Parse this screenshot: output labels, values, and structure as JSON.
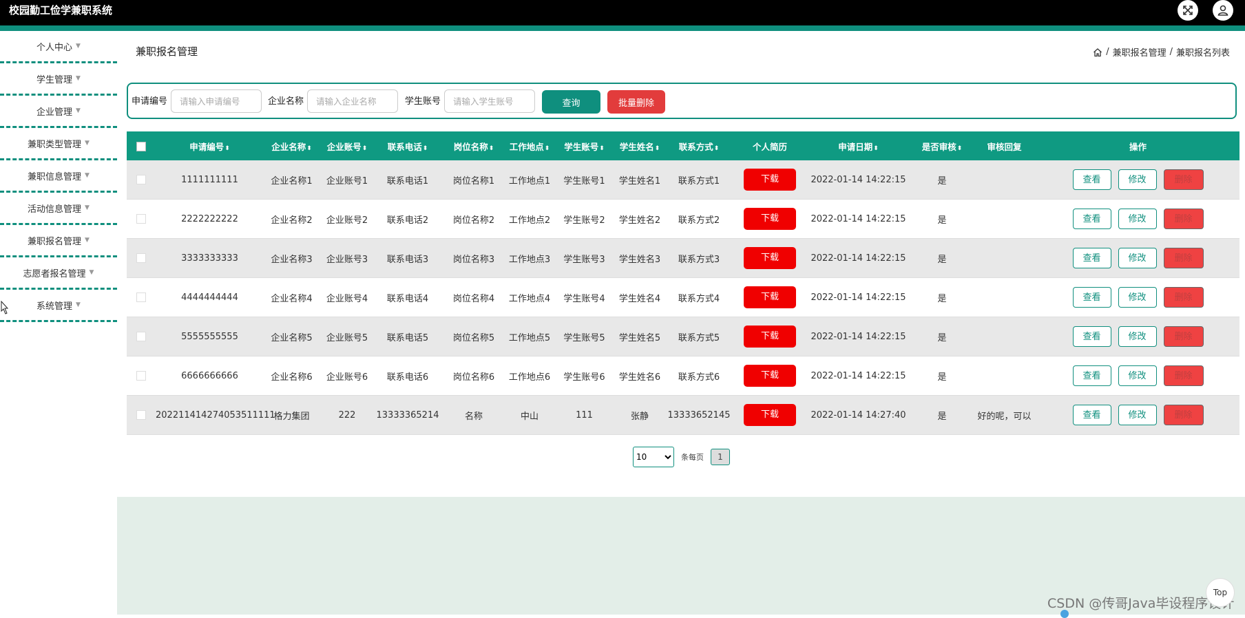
{
  "header": {
    "app_title": "校园勤工俭学兼职系统",
    "fullscreen_icon": "fullscreen-icon",
    "user_icon": "user-icon",
    "accent_color": "#0f8f7e"
  },
  "sidebar": {
    "items": [
      {
        "label": "个人中心"
      },
      {
        "label": "学生管理"
      },
      {
        "label": "企业管理"
      },
      {
        "label": "兼职类型管理"
      },
      {
        "label": "兼职信息管理"
      },
      {
        "label": "活动信息管理"
      },
      {
        "label": "兼职报名管理"
      },
      {
        "label": "志愿者报名管理"
      },
      {
        "label": "系统管理"
      }
    ]
  },
  "page": {
    "title": "兼职报名管理",
    "breadcrumb": [
      "兼职报名管理",
      "兼职报名列表"
    ],
    "breadcrumb_sep": "/"
  },
  "search": {
    "fields": [
      {
        "label": "申请编号",
        "placeholder": "请输入申请编号"
      },
      {
        "label": "企业名称",
        "placeholder": "请输入企业名称"
      },
      {
        "label": "学生账号",
        "placeholder": "请输入学生账号"
      }
    ],
    "query_label": "查询",
    "batch_delete_label": "批量删除"
  },
  "table": {
    "columns": [
      {
        "label": "申请编号",
        "sortable": true
      },
      {
        "label": "企业名称",
        "sortable": true
      },
      {
        "label": "企业账号",
        "sortable": true
      },
      {
        "label": "联系电话",
        "sortable": true
      },
      {
        "label": "岗位名称",
        "sortable": true
      },
      {
        "label": "工作地点",
        "sortable": true
      },
      {
        "label": "学生账号",
        "sortable": true
      },
      {
        "label": "学生姓名",
        "sortable": true
      },
      {
        "label": "联系方式",
        "sortable": true
      },
      {
        "label": "个人简历",
        "sortable": false
      },
      {
        "label": "申请日期",
        "sortable": true
      },
      {
        "label": "是否审核",
        "sortable": true
      },
      {
        "label": "审核回复",
        "sortable": false
      },
      {
        "label": "操作",
        "sortable": false
      }
    ],
    "download_label": "下载",
    "view_label": "查看",
    "edit_label": "修改",
    "delete_label": "删除",
    "rows": [
      [
        "1111111111",
        "企业名称1",
        "企业账号1",
        "联系电话1",
        "岗位名称1",
        "工作地点1",
        "学生账号1",
        "学生姓名1",
        "联系方式1",
        "2022-01-14 14:22:15",
        "是",
        ""
      ],
      [
        "2222222222",
        "企业名称2",
        "企业账号2",
        "联系电话2",
        "岗位名称2",
        "工作地点2",
        "学生账号2",
        "学生姓名2",
        "联系方式2",
        "2022-01-14 14:22:15",
        "是",
        ""
      ],
      [
        "3333333333",
        "企业名称3",
        "企业账号3",
        "联系电话3",
        "岗位名称3",
        "工作地点3",
        "学生账号3",
        "学生姓名3",
        "联系方式3",
        "2022-01-14 14:22:15",
        "是",
        ""
      ],
      [
        "4444444444",
        "企业名称4",
        "企业账号4",
        "联系电话4",
        "岗位名称4",
        "工作地点4",
        "学生账号4",
        "学生姓名4",
        "联系方式4",
        "2022-01-14 14:22:15",
        "是",
        ""
      ],
      [
        "5555555555",
        "企业名称5",
        "企业账号5",
        "联系电话5",
        "岗位名称5",
        "工作地点5",
        "学生账号5",
        "学生姓名5",
        "联系方式5",
        "2022-01-14 14:22:15",
        "是",
        ""
      ],
      [
        "6666666666",
        "企业名称6",
        "企业账号6",
        "联系电话6",
        "岗位名称6",
        "工作地点6",
        "学生账号6",
        "学生姓名6",
        "联系方式6",
        "2022-01-14 14:22:15",
        "是",
        ""
      ],
      [
        "202211414274053511111",
        "格力集团",
        "222",
        "13333365214",
        "名称",
        "中山",
        "111",
        "张静",
        "13333652145",
        "2022-01-14 14:27:40",
        "是",
        "好的呢，可以"
      ]
    ]
  },
  "pagination": {
    "page_size": "10",
    "page_size_options": [
      "10"
    ],
    "per_page_label": "条每页",
    "current_page": "1"
  },
  "footer": {
    "watermark": "CSDN @传哥Java毕设程序设计",
    "top_label": "Top"
  }
}
